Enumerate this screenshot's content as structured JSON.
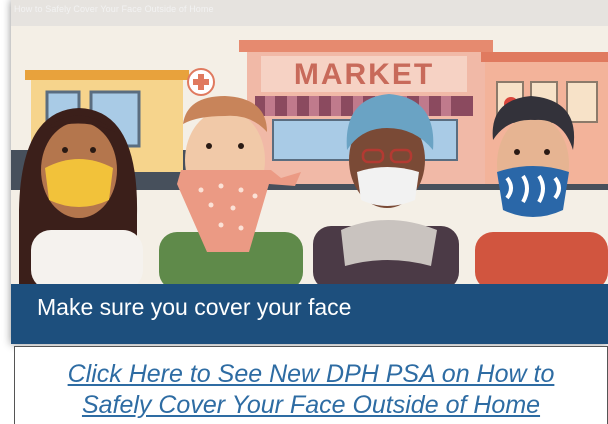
{
  "video": {
    "title": "How to Safely Cover Your Face Outside of Home",
    "store_sign": "MARKET",
    "caption": "Make sure you cover your face"
  },
  "link": {
    "line1": "Click Here to See New DPH PSA on How to",
    "line2": "Safely Cover Your Face Outside of Home"
  },
  "colors": {
    "caption_band": "#1d4f7d",
    "link_text": "#2e6ca3"
  }
}
